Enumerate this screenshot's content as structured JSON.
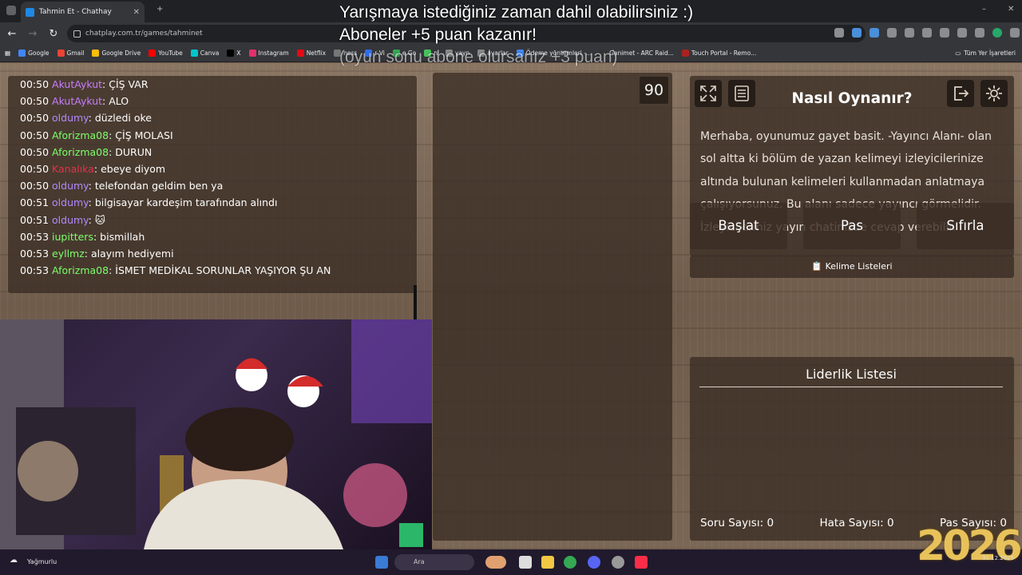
{
  "browser": {
    "tab_title": "Tahmin Et - Chathay",
    "url": "chatplay.com.tr/games/tahminet",
    "bookmarks": [
      {
        "label": "Google",
        "color": "#4285f4"
      },
      {
        "label": "Gmail",
        "color": "#ea4335"
      },
      {
        "label": "Google Drive",
        "color": "#fbbc04"
      },
      {
        "label": "YouTube",
        "color": "#ff0000"
      },
      {
        "label": "Canva",
        "color": "#00c4cc"
      },
      {
        "label": "X",
        "color": "#000000"
      },
      {
        "label": "Instagram",
        "color": "#e1306c"
      },
      {
        "label": "Netflix",
        "color": "#e50914"
      },
      {
        "label": "ness",
        "color": "#777777"
      },
      {
        "label": "r Vi",
        "color": "#2d6ef0"
      },
      {
        "label": "e Go",
        "color": "#34a853"
      },
      {
        "label": "n",
        "color": "#46c25b"
      },
      {
        "label": "yayn",
        "color": "#888888"
      },
      {
        "label": "ayarlar",
        "color": "#888888"
      },
      {
        "label": "Ödeme yöntemleri -...",
        "color": "#4285f4"
      },
      {
        "label": "Ganimet - ARC Raid...",
        "color": "#333333"
      },
      {
        "label": "Touch Portal - Remo...",
        "color": "#aa2222"
      }
    ],
    "bookmarks_right": "Tüm Yer İşaretleri"
  },
  "overlay": {
    "line1": "Yarışmaya istediğiniz zaman dahil olabilirsiniz :)",
    "line2": "Aboneler +5 puan kazanır!",
    "line3": "(oyun sonu abone olursanız +3 puan)"
  },
  "chat": {
    "messages": [
      {
        "time": "00:50",
        "user": "AkutAykut",
        "user_color": "#c77dff",
        "text": "ÇİŞ VAR"
      },
      {
        "time": "00:50",
        "user": "AkutAykut",
        "user_color": "#c77dff",
        "text": "ALO"
      },
      {
        "time": "00:50",
        "user": "oldumy",
        "user_color": "#b388ff",
        "text": "düzledi oke"
      },
      {
        "time": "00:50",
        "user": "Aforizma08",
        "user_color": "#7dff6b",
        "text": "ÇİŞ MOLASI"
      },
      {
        "time": "00:50",
        "user": "Aforizma08",
        "user_color": "#7dff6b",
        "text": "DURUN"
      },
      {
        "time": "00:50",
        "user": "Kanalıka",
        "user_color": "#e0334a",
        "text": "ebeye diyom"
      },
      {
        "time": "00:50",
        "user": "oldumy",
        "user_color": "#b388ff",
        "text": "telefondan geldim ben ya"
      },
      {
        "time": "00:51",
        "user": "oldumy",
        "user_color": "#b388ff",
        "text": "bilgisayar kardeşim tarafından alındı"
      },
      {
        "time": "00:51",
        "user": "oldumy",
        "user_color": "#b388ff",
        "text": "🐱"
      },
      {
        "time": "00:53",
        "user": "iupitters",
        "user_color": "#7dff6b",
        "text": "bismillah"
      },
      {
        "time": "00:53",
        "user": "eyllmz",
        "user_color": "#7dff6b",
        "text": "alayım hediyemi"
      },
      {
        "time": "00:53",
        "user": "Aforizma08",
        "user_color": "#7dff6b",
        "text": "İSMET MEDİKAL SORUNLAR YAŞIYOR ŞU AN"
      }
    ]
  },
  "game": {
    "timer": "90",
    "howto_title": "Nasıl Oynanır?",
    "howto_text": "Merhaba, oyunumuz gayet basit. -Yayıncı Alanı- olan sol altta ki bölüm de yazan kelimeyi izleyicilerinize altında bulunan kelimeleri kullanmadan anlatmaya çalışıyorsunuz. Bu alanı sadece yayıncı görmelidir. İzleyicileriniz yayın chatinizde cevap verebilir.",
    "buttons": {
      "start": "Başlat",
      "pass": "Pas",
      "reset": "Sıfırla"
    },
    "wordlists_label": "Kelime Listeleri",
    "leaderboard_title": "Liderlik Listesi",
    "stats": {
      "questions_label": "Soru Sayısı:",
      "questions": "0",
      "errors_label": "Hata Sayısı:",
      "errors": "0",
      "passes_label": "Pas Sayısı:",
      "passes": "0"
    }
  },
  "taskbar": {
    "weather": "Yağmurlu",
    "search_placeholder": "Ara",
    "year_overlay": "2026",
    "date": "31.12.2025"
  }
}
